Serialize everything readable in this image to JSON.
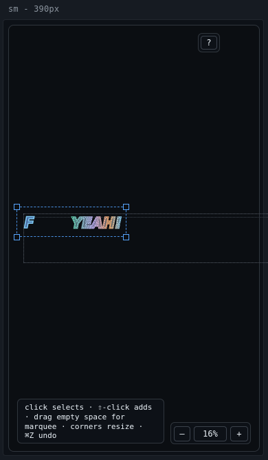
{
  "frame": {
    "title": "sm - 390px"
  },
  "toolbar": {
    "help_label": "?"
  },
  "canvas": {
    "artwork_f": "F",
    "artwork_yeah": "YEAH!"
  },
  "hint": {
    "text": "click selects · ⇧-click adds · drag empty space for marquee · corners resize · ⌘Z undo"
  },
  "zoom": {
    "decrease_label": "–",
    "level": "16%",
    "increase_label": "+"
  },
  "colors": {
    "selection": "#4a90e2",
    "canvas_bg": "#0b0e12"
  }
}
